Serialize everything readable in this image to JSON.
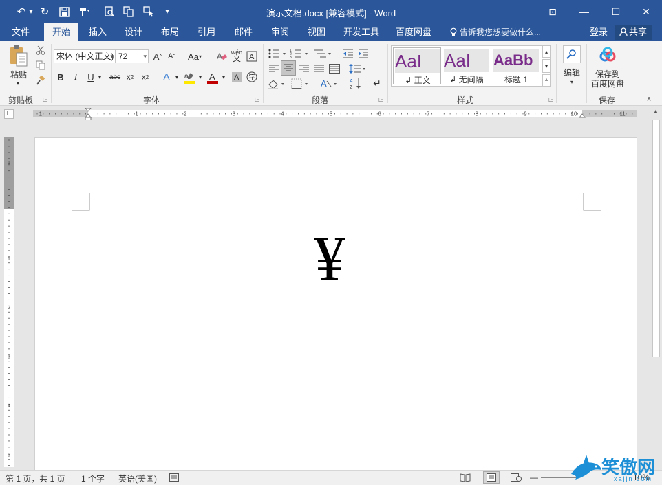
{
  "window": {
    "title": "演示文档.docx [兼容模式] - Word",
    "minimize_glyph": "—",
    "maximize_glyph": "☐",
    "close_glyph": "✕",
    "ribbon_display_glyph": "⊡"
  },
  "quick_access": [
    {
      "name": "undo-icon",
      "glyph": "↶"
    },
    {
      "name": "dropdown-icon",
      "glyph": "▾"
    },
    {
      "name": "redo-icon",
      "glyph": "↻"
    },
    {
      "name": "save-icon",
      "glyph": "💾"
    },
    {
      "name": "format-painter-qa-icon",
      "glyph": "⊏"
    },
    {
      "name": "print-preview-icon",
      "glyph": "🔍"
    },
    {
      "name": "copy-format-icon",
      "glyph": "⧉"
    },
    {
      "name": "pointer-mode-icon",
      "glyph": "↖"
    },
    {
      "name": "customize-qa-icon",
      "glyph": "▾"
    }
  ],
  "tabs": [
    "文件",
    "开始",
    "插入",
    "设计",
    "布局",
    "引用",
    "邮件",
    "审阅",
    "视图",
    "开发工具",
    "百度网盘"
  ],
  "active_tab": "开始",
  "tell_me": "告诉我您想要做什么...",
  "login": "登录",
  "share": "共享",
  "ribbon": {
    "clipboard": {
      "label": "剪贴板",
      "paste": "粘贴"
    },
    "font": {
      "label": "字体",
      "font_name": "宋体 (中文正文)",
      "font_size": "72"
    },
    "paragraph": {
      "label": "段落"
    },
    "styles": {
      "label": "样式",
      "items": [
        {
          "sample": "AaI",
          "name": "↲ 正文"
        },
        {
          "sample": "AaI",
          "name": "↲ 无间隔"
        },
        {
          "sample": "AaBb",
          "name": "标题 1"
        }
      ]
    },
    "editing": {
      "label": "编辑"
    },
    "save": {
      "label": "保存",
      "button": "保存到\n百度网盘",
      "line1": "保存到",
      "line2": "百度网盘"
    }
  },
  "ruler": {
    "h_labels": [
      "1",
      "1",
      "2",
      "3",
      "4",
      "5",
      "6",
      "7",
      "8",
      "9",
      "10",
      "11"
    ],
    "v_labels": [
      "1",
      "1",
      "2",
      "3",
      "4",
      "5"
    ]
  },
  "document": {
    "content": "¥"
  },
  "status": {
    "page": "第 1 页，共 1 页",
    "words": "1 个字",
    "language": "英语(美国)",
    "zoom": "10%"
  },
  "watermark": {
    "text": "笑傲网",
    "url": "xajjn.com"
  },
  "colors": {
    "accent": "#2b579a",
    "style_purple": "#7a2c8a"
  }
}
